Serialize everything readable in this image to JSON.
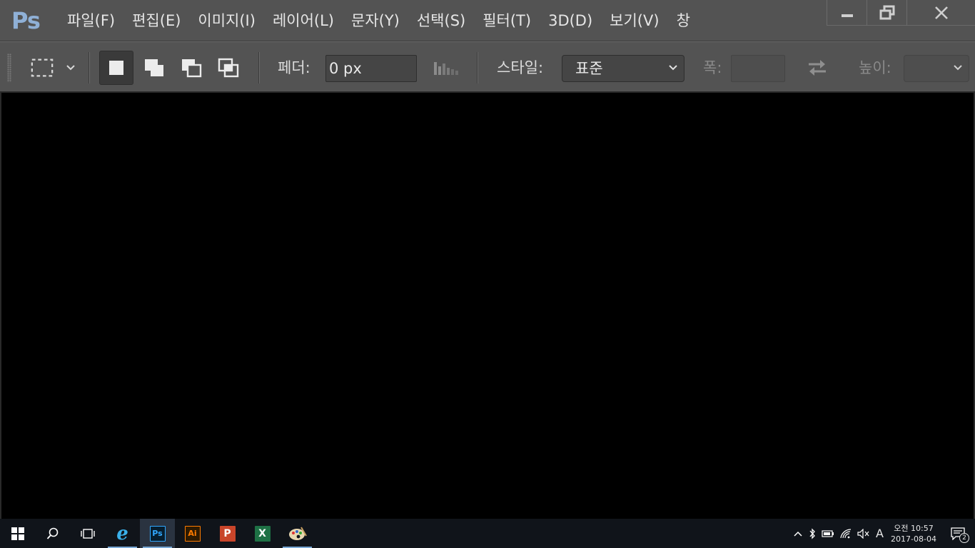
{
  "app": {
    "logo": "Ps",
    "menu": [
      {
        "label": "파일(F)"
      },
      {
        "label": "편집(E)"
      },
      {
        "label": "이미지(I)"
      },
      {
        "label": "레이어(L)"
      },
      {
        "label": "문자(Y)"
      },
      {
        "label": "선택(S)"
      },
      {
        "label": "필터(T)"
      },
      {
        "label": "3D(D)"
      },
      {
        "label": "보기(V)"
      },
      {
        "label": "창"
      }
    ],
    "window_controls": [
      "minimize-icon",
      "restore-icon",
      "close-icon"
    ]
  },
  "options": {
    "feather_label": "페더:",
    "feather_value": "0 px",
    "style_label": "스타일:",
    "style_value": "표준",
    "width_label": "폭:",
    "width_value": "",
    "height_label": "높이:",
    "height_value": ""
  },
  "taskbar": {
    "apps": [
      {
        "name": "internet-explorer",
        "label": "e",
        "color": "#3ab0ea"
      },
      {
        "name": "photoshop",
        "label": "Ps",
        "color": "#31a8ff",
        "bg": "#061e2f"
      },
      {
        "name": "illustrator",
        "label": "Ai",
        "color": "#ff7c00",
        "bg": "#2e1a00"
      },
      {
        "name": "powerpoint",
        "label": "P",
        "color": "#ffffff",
        "bg": "#c9452a"
      },
      {
        "name": "excel",
        "label": "X",
        "color": "#ffffff",
        "bg": "#1e7145"
      },
      {
        "name": "paint",
        "label": "🎨",
        "color": "#e6e6e6"
      }
    ],
    "ime": "A",
    "clock_time": "오전 10:57",
    "clock_date": "2017-08-04",
    "notification_count": "2"
  },
  "colors": {
    "chrome": "#535353",
    "canvas": "#000000",
    "taskbar": "#10141a",
    "ps_blue": "#8fb0d6"
  }
}
